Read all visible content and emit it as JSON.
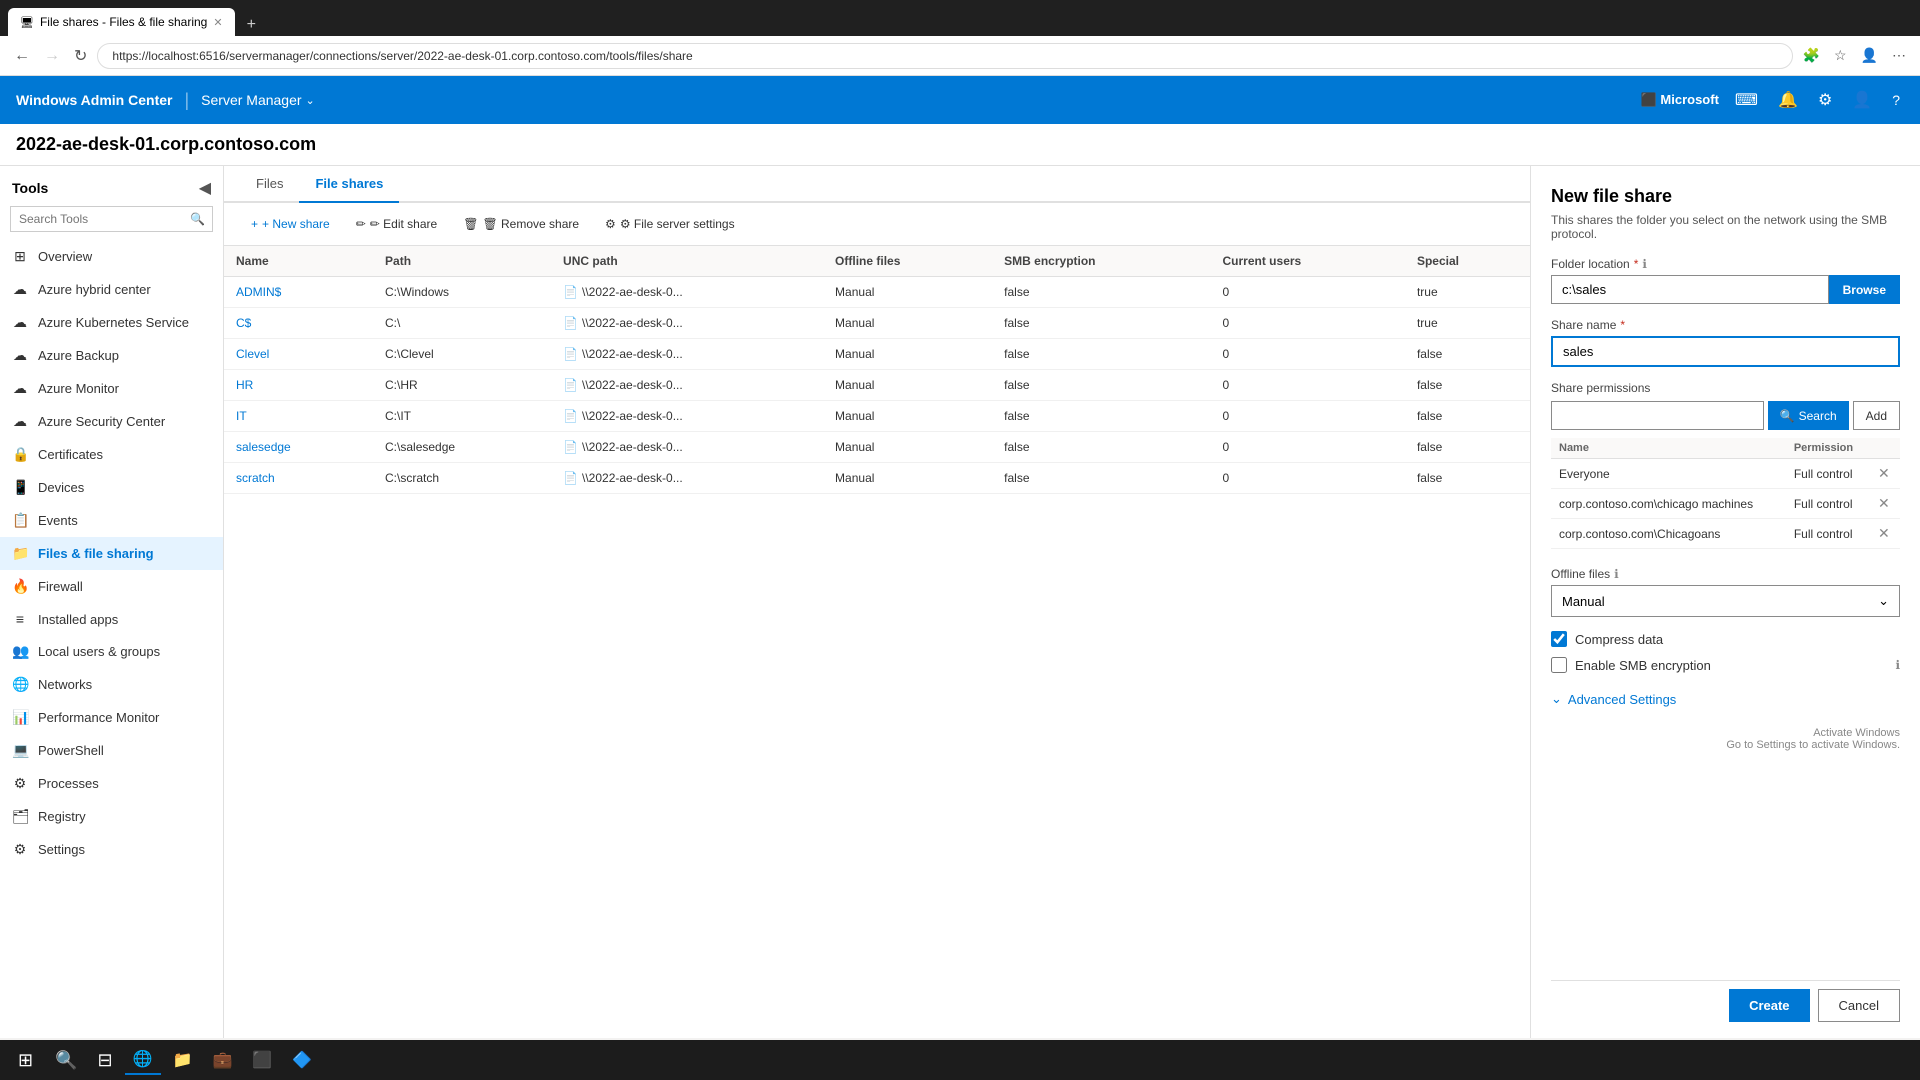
{
  "browser": {
    "tab_title": "File shares - Files & file sharing",
    "tab_icon": "🖥",
    "address": "https://localhost:6516/servermanager/connections/server/2022-ae-desk-01.corp.contoso.com/tools/files/share",
    "new_tab_icon": "+",
    "back_btn": "←",
    "forward_btn": "→",
    "refresh_btn": "↻"
  },
  "appbar": {
    "title": "Windows Admin Center",
    "divider": "|",
    "server_manager": "Server Manager",
    "chevron": "⌄",
    "microsoft_logo": "⬛ Microsoft",
    "terminal_icon": "⌨",
    "notification_icon": "🔔",
    "settings_icon": "⚙",
    "user_icon": "👤",
    "help_icon": "?"
  },
  "server_title": "2022-ae-desk-01.corp.contoso.com",
  "sidebar": {
    "tools_label": "Tools",
    "search_placeholder": "Search Tools",
    "collapse_icon": "◀",
    "items": [
      {
        "label": "Overview",
        "icon": "⊞",
        "active": false
      },
      {
        "label": "Azure hybrid center",
        "icon": "☁",
        "active": false
      },
      {
        "label": "Azure Kubernetes Service",
        "icon": "☁",
        "active": false
      },
      {
        "label": "Azure Backup",
        "icon": "☁",
        "active": false
      },
      {
        "label": "Azure Monitor",
        "icon": "☁",
        "active": false
      },
      {
        "label": "Azure Security Center",
        "icon": "☁",
        "active": false
      },
      {
        "label": "Certificates",
        "icon": "🔒",
        "active": false
      },
      {
        "label": "Devices",
        "icon": "📱",
        "active": false
      },
      {
        "label": "Events",
        "icon": "📋",
        "active": false
      },
      {
        "label": "Files & file sharing",
        "icon": "📁",
        "active": true
      },
      {
        "label": "Firewall",
        "icon": "🔥",
        "active": false
      },
      {
        "label": "Installed apps",
        "icon": "≡",
        "active": false
      },
      {
        "label": "Local users & groups",
        "icon": "👥",
        "active": false
      },
      {
        "label": "Networks",
        "icon": "🌐",
        "active": false
      },
      {
        "label": "Performance Monitor",
        "icon": "📊",
        "active": false
      },
      {
        "label": "PowerShell",
        "icon": "💻",
        "active": false
      },
      {
        "label": "Processes",
        "icon": "⚙",
        "active": false
      },
      {
        "label": "Registry",
        "icon": "🗂",
        "active": false
      },
      {
        "label": "Settings",
        "icon": "⚙",
        "active": false
      }
    ]
  },
  "tabs": [
    {
      "label": "Files",
      "active": false
    },
    {
      "label": "File shares",
      "active": true
    }
  ],
  "toolbar": {
    "new_share": "+ New share",
    "edit_share": "✏ Edit share",
    "remove_share": "🗑 Remove share",
    "file_server_settings": "⚙ File server settings"
  },
  "table": {
    "columns": [
      "Name",
      "Path",
      "UNC path",
      "Offline files",
      "SMB encryption",
      "Current users",
      "Special"
    ],
    "rows": [
      {
        "name": "ADMIN$",
        "path": "C:\\Windows",
        "unc": "\\\\2022-ae-desk-0...",
        "offline": "Manual",
        "smb": "false",
        "users": "0",
        "special": "true"
      },
      {
        "name": "C$",
        "path": "C:\\",
        "unc": "\\\\2022-ae-desk-0...",
        "offline": "Manual",
        "smb": "false",
        "users": "0",
        "special": "true"
      },
      {
        "name": "Clevel",
        "path": "C:\\Clevel",
        "unc": "\\\\2022-ae-desk-0...",
        "offline": "Manual",
        "smb": "false",
        "users": "0",
        "special": "false"
      },
      {
        "name": "HR",
        "path": "C:\\HR",
        "unc": "\\\\2022-ae-desk-0...",
        "offline": "Manual",
        "smb": "false",
        "users": "0",
        "special": "false"
      },
      {
        "name": "IT",
        "path": "C:\\IT",
        "unc": "\\\\2022-ae-desk-0...",
        "offline": "Manual",
        "smb": "false",
        "users": "0",
        "special": "false"
      },
      {
        "name": "salesedge",
        "path": "C:\\salesedge",
        "unc": "\\\\2022-ae-desk-0...",
        "offline": "Manual",
        "smb": "false",
        "users": "0",
        "special": "false"
      },
      {
        "name": "scratch",
        "path": "C:\\scratch",
        "unc": "\\\\2022-ae-desk-0...",
        "offline": "Manual",
        "smb": "false",
        "users": "0",
        "special": "false"
      }
    ]
  },
  "panel": {
    "title": "New file share",
    "subtitle": "This shares the folder you select on the network using the SMB protocol.",
    "folder_location_label": "Folder location",
    "folder_location_value": "c:\\sales",
    "browse_btn": "Browse",
    "share_name_label": "Share name",
    "share_name_value": "sales",
    "share_permissions_label": "Share permissions",
    "permissions_search_placeholder": "",
    "search_btn": "Search",
    "add_btn": "Add",
    "permissions_cols": [
      "Name",
      "Permission"
    ],
    "permissions": [
      {
        "name": "Everyone",
        "permission": "Full control"
      },
      {
        "name": "corp.contoso.com\\chicago machines",
        "permission": "Full control"
      },
      {
        "name": "corp.contoso.com\\Chicagoans",
        "permission": "Full control"
      }
    ],
    "offline_files_label": "Offline files",
    "offline_files_value": "Manual",
    "compress_data_label": "Compress data",
    "compress_data_checked": true,
    "enable_smb_label": "Enable SMB encryption",
    "enable_smb_checked": false,
    "advanced_settings_label": "Advanced Settings",
    "windows_activation_line1": "Activate Windows",
    "windows_activation_line2": "Go to Settings to activate Windows.",
    "create_btn": "Create",
    "cancel_btn": "Cancel"
  },
  "taskbar": {
    "apps": [
      "⊞",
      "🔍",
      "⊟",
      "🌐",
      "📁",
      "💼",
      "⬛",
      "🔷"
    ]
  }
}
